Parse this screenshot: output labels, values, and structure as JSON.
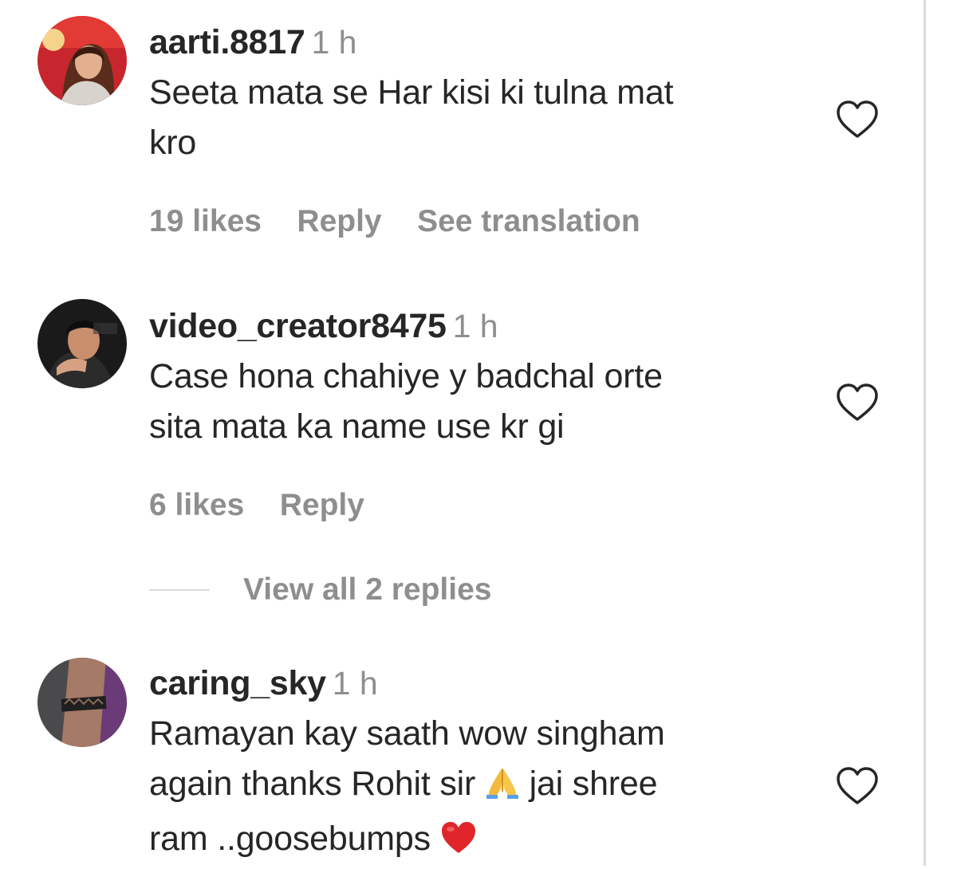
{
  "comments": [
    {
      "username": "aarti.8817",
      "time": "1 h",
      "text_lines": [
        "Seeta mata se Har kisi ki tulna mat",
        "kro"
      ],
      "likes": "19 likes",
      "reply": "Reply",
      "translation": "See translation",
      "avatar_icon": "profile-photo"
    },
    {
      "username": "video_creator8475",
      "time": "1 h",
      "text_lines": [
        "Case hona chahiye y badchal orte",
        "sita mata ka name use kr gi"
      ],
      "likes": "6 likes",
      "reply": "Reply",
      "avatar_icon": "profile-photo"
    },
    {
      "username": "caring_sky",
      "time": "1 h",
      "text_lines": [
        "Ramayan kay saath wow singham",
        "again thanks Rohit sir",
        "jai shree",
        "ram ..goosebumps"
      ],
      "emoji": [
        "folded-hands-emoji",
        "red-heart-emoji"
      ],
      "avatar_icon": "profile-photo"
    }
  ],
  "view_replies": "View all 2 replies",
  "like_icon": "heart-outline-icon",
  "colors": {
    "primary_text": "#262626",
    "secondary_text": "#8e8e8e",
    "divider": "#dbdbdb"
  }
}
